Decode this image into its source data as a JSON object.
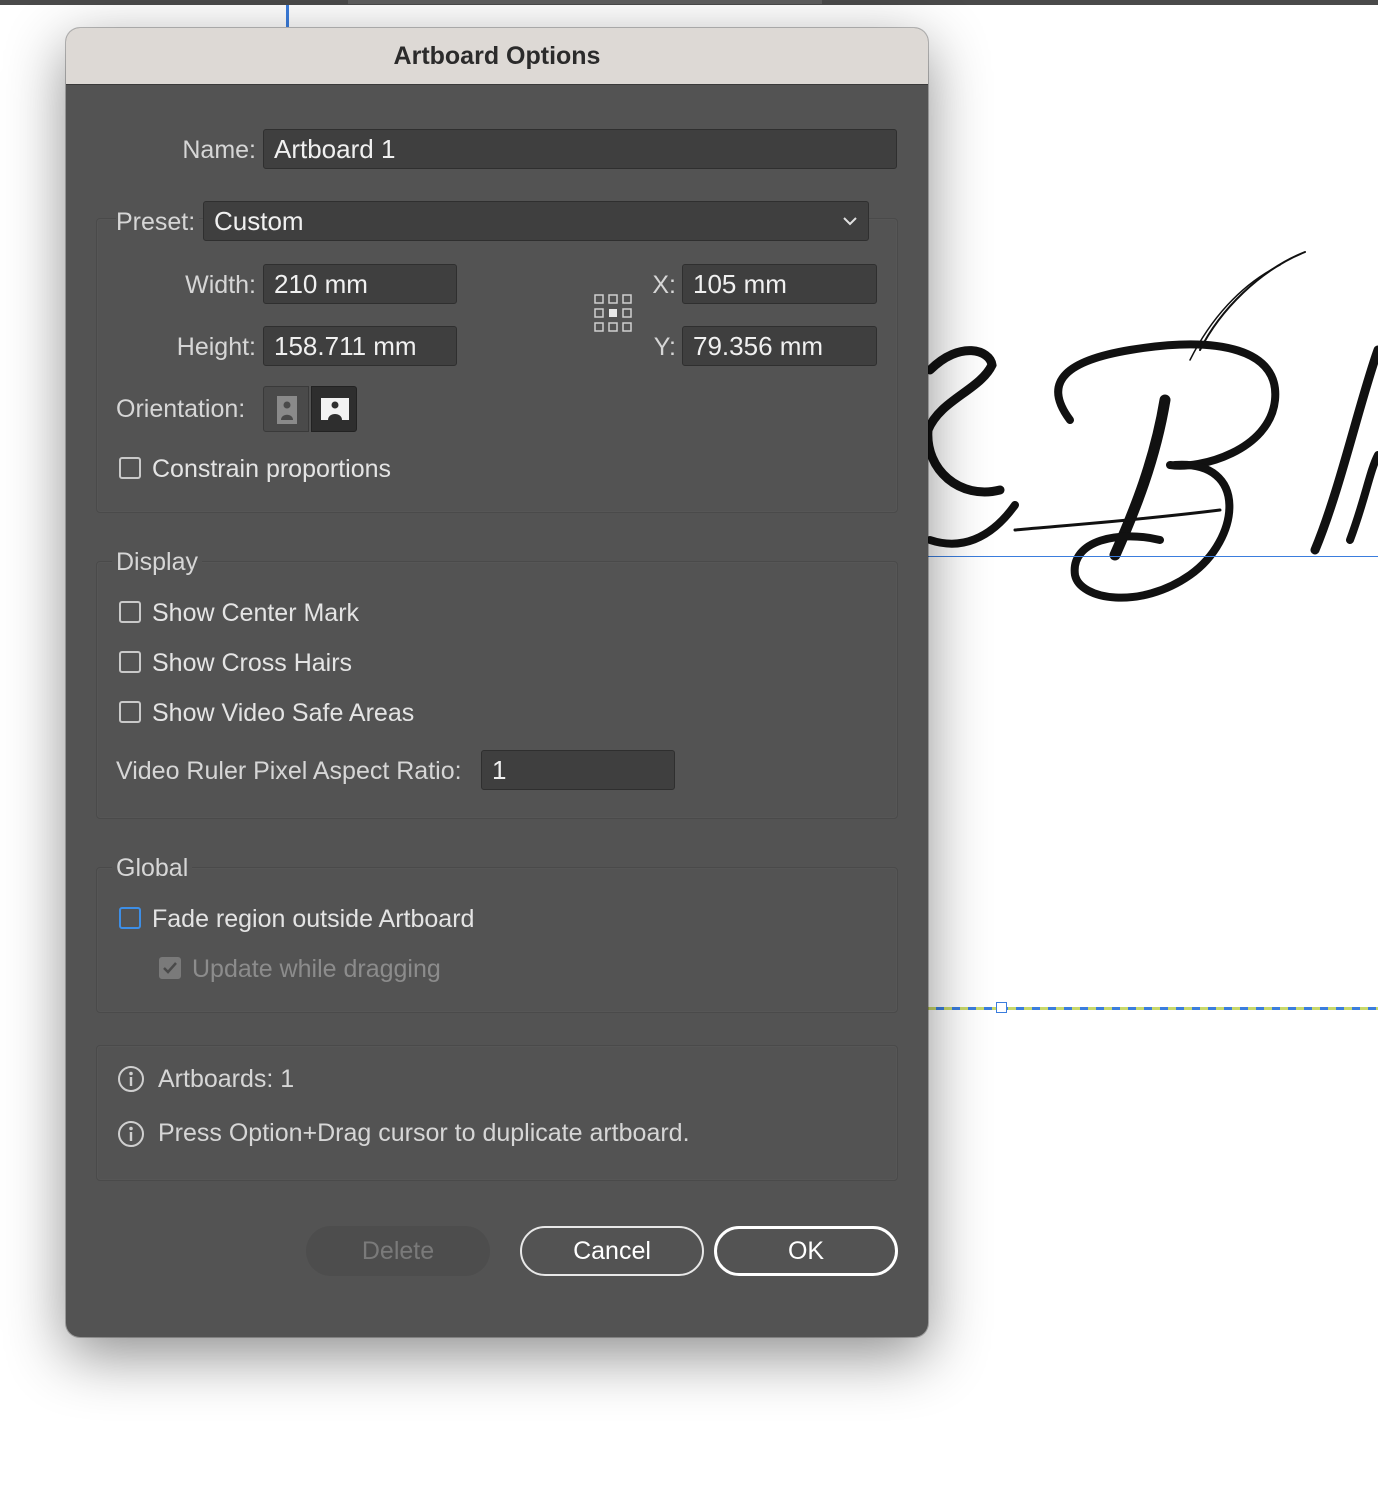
{
  "dialog": {
    "title": "Artboard Options",
    "name_label": "Name:",
    "name_value": "Artboard 1",
    "preset_label": "Preset:",
    "preset_value": "Custom",
    "width_label": "Width:",
    "width_value": "210 mm",
    "height_label": "Height:",
    "height_value": "158.711 mm",
    "x_label": "X:",
    "x_value": "105 mm",
    "y_label": "Y:",
    "y_value": "79.356 mm",
    "orientation_label": "Orientation:",
    "orientation_selected": "landscape",
    "constrain_label": "Constrain proportions",
    "constrain_checked": false
  },
  "display": {
    "title": "Display",
    "show_center_mark": "Show Center Mark",
    "show_cross_hairs": "Show Cross Hairs",
    "show_video_safe": "Show Video Safe Areas",
    "video_ratio_label": "Video Ruler Pixel Aspect Ratio:",
    "video_ratio_value": "1"
  },
  "global": {
    "title": "Global",
    "fade_label": "Fade region outside Artboard",
    "fade_checked": false,
    "update_label": "Update while dragging",
    "update_checked": true
  },
  "info": {
    "artboards": "Artboards: 1",
    "hint": "Press Option+Drag cursor to duplicate artboard."
  },
  "buttons": {
    "delete": "Delete",
    "cancel": "Cancel",
    "ok": "OK"
  },
  "colors": {
    "dialog_bg": "#535353",
    "titlebar_bg": "#ddd9d5",
    "accent": "#3d8ee6"
  }
}
